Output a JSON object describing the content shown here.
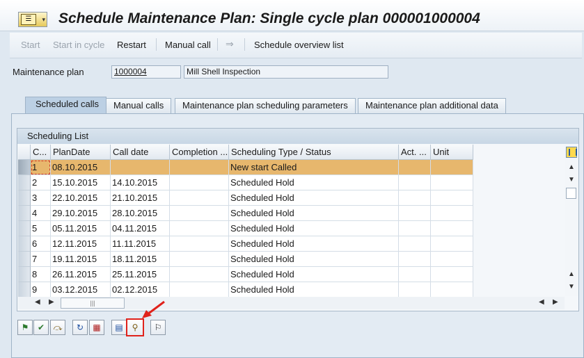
{
  "title": "Schedule Maintenance Plan: Single cycle plan 000001000004",
  "app_toolbar": {
    "start": "Start",
    "start_in_cycle": "Start in cycle",
    "restart": "Restart",
    "manual_call": "Manual call",
    "schedule_overview": "Schedule overview list"
  },
  "header": {
    "plan_label": "Maintenance plan",
    "plan_number": "1000004",
    "plan_description": "Mill Shell Inspection"
  },
  "tabs": [
    {
      "label": "Scheduled calls",
      "active": true
    },
    {
      "label": "Manual calls"
    },
    {
      "label": "Maintenance plan scheduling parameters"
    },
    {
      "label": "Maintenance plan additional data"
    }
  ],
  "scheduling_list": {
    "title": "Scheduling List",
    "columns": [
      "C...",
      "PlanDate",
      "Call date",
      "Completion ...",
      "Scheduling Type / Status",
      "Act. ...",
      "Unit"
    ],
    "rows": [
      [
        "1",
        "08.10.2015",
        "",
        "",
        "New start  Called",
        "",
        ""
      ],
      [
        "2",
        "15.10.2015",
        "14.10.2015",
        "",
        "Scheduled  Hold",
        "",
        ""
      ],
      [
        "3",
        "22.10.2015",
        "21.10.2015",
        "",
        "Scheduled  Hold",
        "",
        ""
      ],
      [
        "4",
        "29.10.2015",
        "28.10.2015",
        "",
        "Scheduled  Hold",
        "",
        ""
      ],
      [
        "5",
        "05.11.2015",
        "04.11.2015",
        "",
        "Scheduled  Hold",
        "",
        ""
      ],
      [
        "6",
        "12.11.2015",
        "11.11.2015",
        "",
        "Scheduled  Hold",
        "",
        ""
      ],
      [
        "7",
        "19.11.2015",
        "18.11.2015",
        "",
        "Scheduled  Hold",
        "",
        ""
      ],
      [
        "8",
        "26.11.2015",
        "25.11.2015",
        "",
        "Scheduled  Hold",
        "",
        ""
      ],
      [
        "9",
        "03.12.2015",
        "02.12.2015",
        "",
        "Scheduled  Hold",
        "",
        ""
      ]
    ],
    "selected_row": 0
  },
  "bottom_toolbar_icons": [
    "release-call-icon",
    "fix-call-icon",
    "skip-call-icon",
    "refresh-icon",
    "calendar-icon",
    "calculator-icon",
    "call-object-icon",
    "flag-icon"
  ],
  "highlighted_icon": "call-object-icon",
  "colors": {
    "selected_row": "#e7b76d",
    "highlight_border": "#e0221b"
  }
}
